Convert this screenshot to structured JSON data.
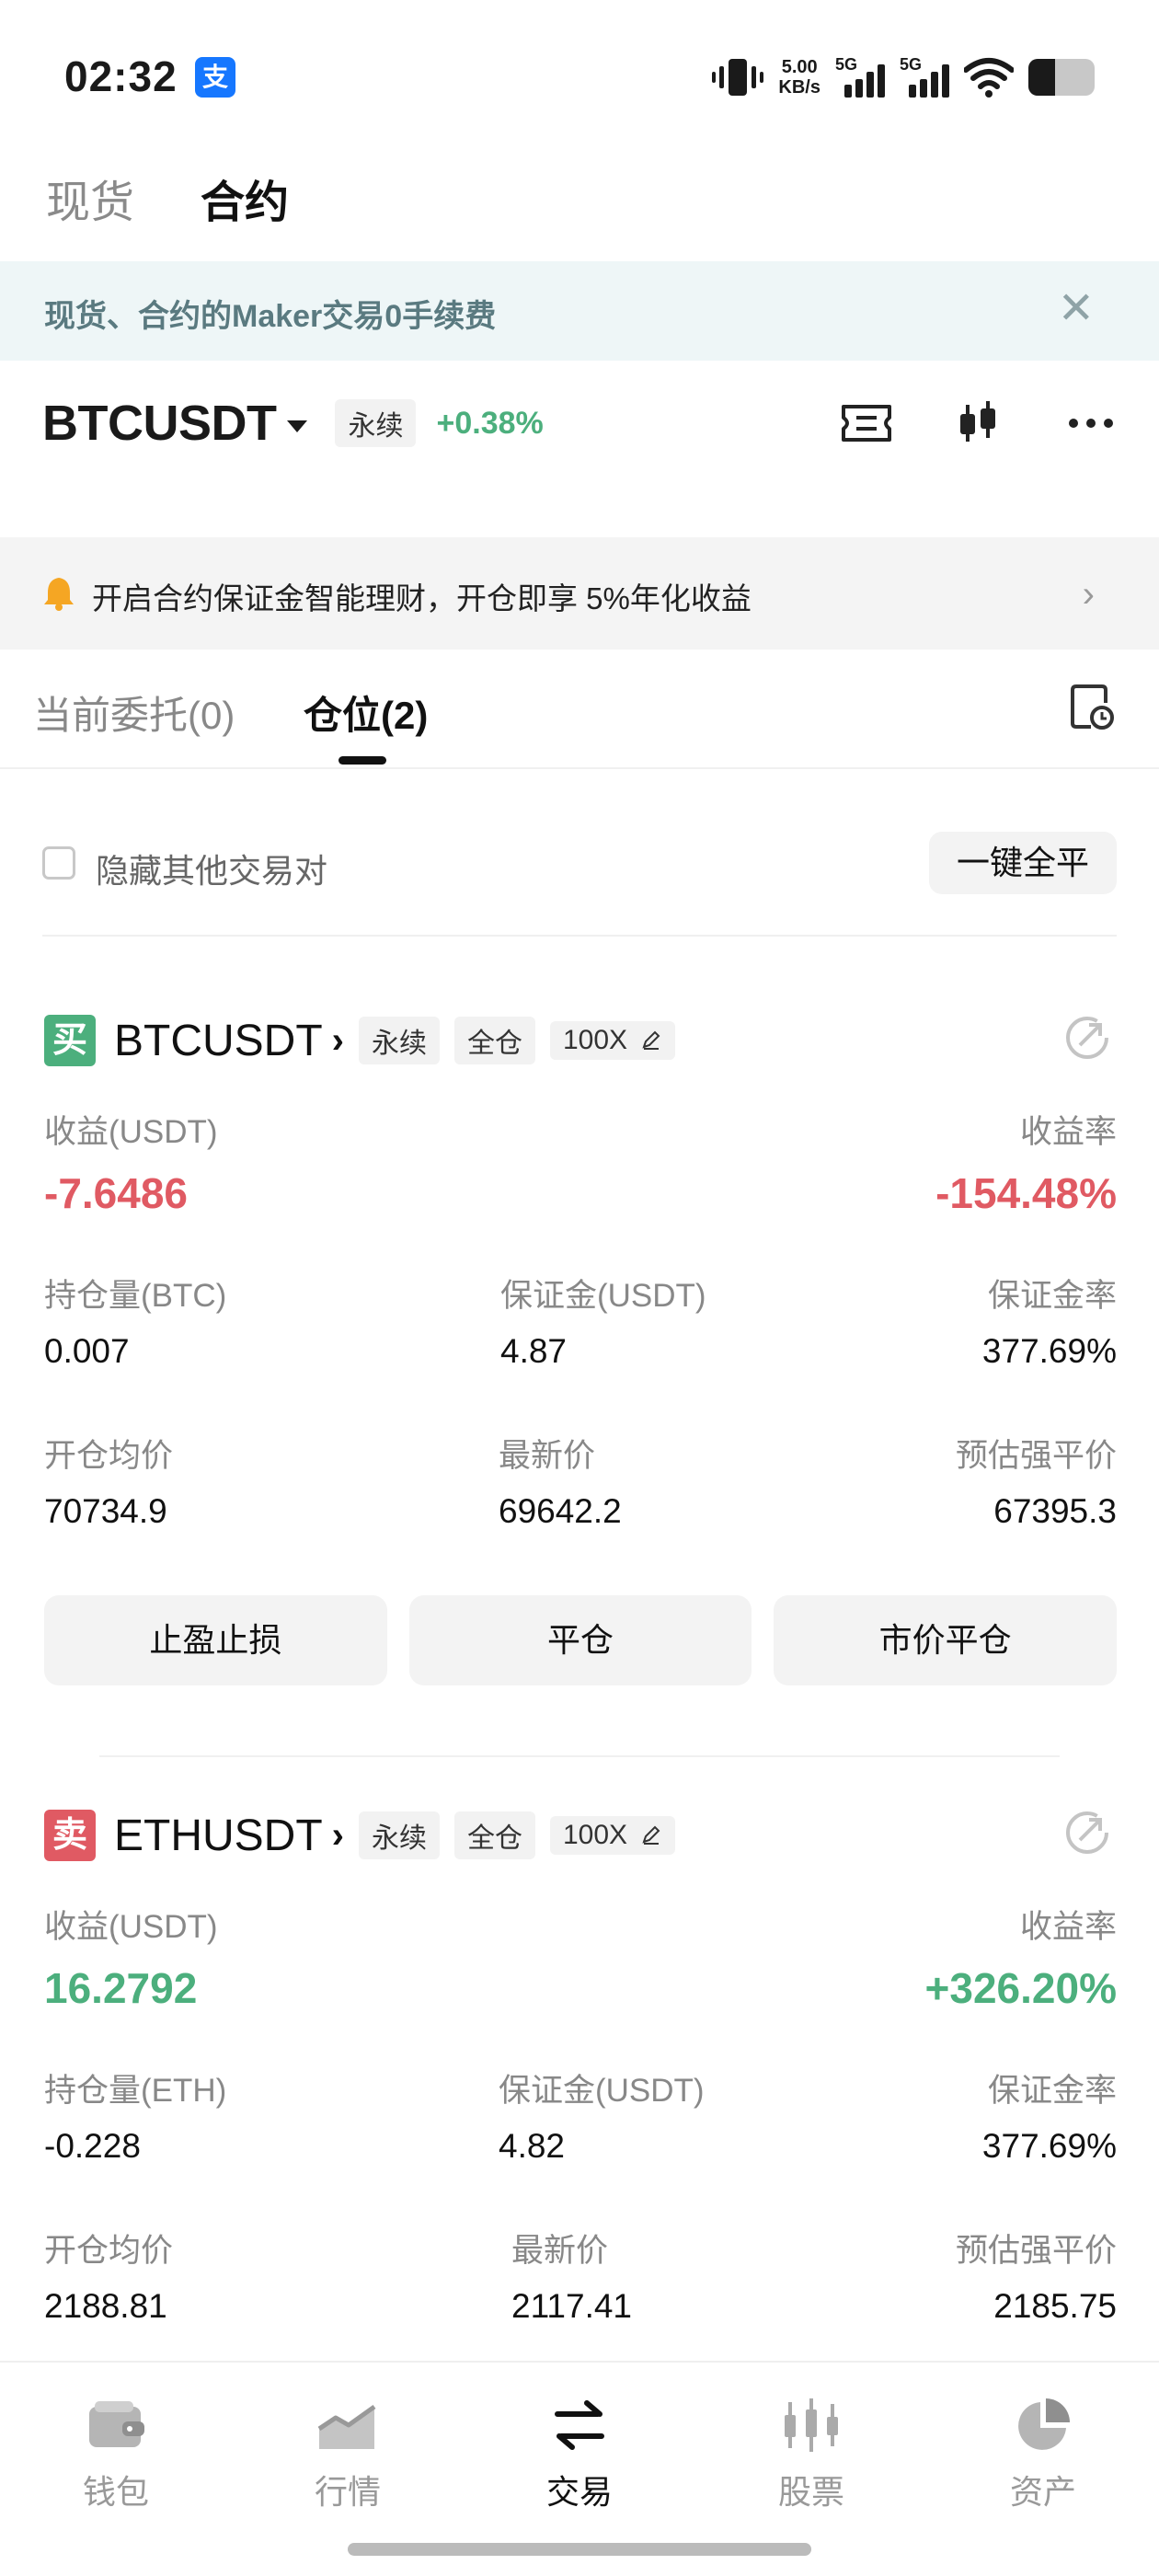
{
  "status_bar": {
    "time": "02:32",
    "app_icon_label": "支",
    "net_speed_value": "5.00",
    "net_speed_unit": "KB/s",
    "sim1": "5G",
    "sim2": "5G",
    "battery_level": 0.4
  },
  "top_tabs": [
    {
      "label": "现货",
      "active": false
    },
    {
      "label": "合约",
      "active": true
    }
  ],
  "promo_banner": {
    "text": "现货、合约的Maker交易0手续费",
    "close": "✕"
  },
  "symbol_header": {
    "symbol": "BTCUSDT",
    "type_tag": "永续",
    "change": "+0.38%"
  },
  "notice": {
    "text": "开启合约保证金智能理财，开仓即享 5%年化收益",
    "arrow": "›"
  },
  "position_tabs": {
    "open_orders": "当前委托(0)",
    "positions": "仓位(2)"
  },
  "filter": {
    "hide_others_label": "隐藏其他交易对",
    "hide_others_checked": false,
    "close_all_button": "一键全平"
  },
  "positions": [
    {
      "side_label": "买",
      "side": "buy",
      "symbol": "BTCUSDT",
      "chevron": "›",
      "tags": [
        "永续",
        "全仓",
        "100X"
      ],
      "pnl_label": "收益(USDT)",
      "pnl": "-7.6486",
      "roe_label": "收益率",
      "roe": "-154.48%",
      "size_label": "持仓量(BTC)",
      "size": "0.007",
      "margin_label": "保证金(USDT)",
      "margin": "4.87",
      "margin_ratio_label": "保证金率",
      "margin_ratio": "377.69%",
      "entry_label": "开仓均价",
      "entry": "70734.9",
      "last_label": "最新价",
      "last": "69642.2",
      "liq_label": "预估强平价",
      "liq": "67395.3",
      "actions": [
        "止盈止损",
        "平仓",
        "市价平仓"
      ]
    },
    {
      "side_label": "卖",
      "side": "sell",
      "symbol": "ETHUSDT",
      "chevron": "›",
      "tags": [
        "永续",
        "全仓",
        "100X"
      ],
      "pnl_label": "收益(USDT)",
      "pnl": "16.2792",
      "roe_label": "收益率",
      "roe": "+326.20%",
      "size_label": "持仓量(ETH)",
      "size": "-0.228",
      "margin_label": "保证金(USDT)",
      "margin": "4.82",
      "margin_ratio_label": "保证金率",
      "margin_ratio": "377.69%",
      "entry_label": "开仓均价",
      "entry": "2188.81",
      "last_label": "最新价",
      "last": "2117.41",
      "liq_label": "预估强平价",
      "liq": "2185.75"
    }
  ],
  "bottom_nav": [
    {
      "label": "钱包",
      "icon": "wallet-icon",
      "active": false
    },
    {
      "label": "行情",
      "icon": "market-chart-icon",
      "active": false
    },
    {
      "label": "交易",
      "icon": "trade-swap-icon",
      "active": true
    },
    {
      "label": "股票",
      "icon": "stocks-candles-icon",
      "active": false
    },
    {
      "label": "资产",
      "icon": "assets-pie-icon",
      "active": false
    }
  ],
  "colors": {
    "positive": "#4caf7d",
    "negative": "#e05a63",
    "promo_bg": "#eef6f7",
    "promo_text": "#5a7a80"
  }
}
